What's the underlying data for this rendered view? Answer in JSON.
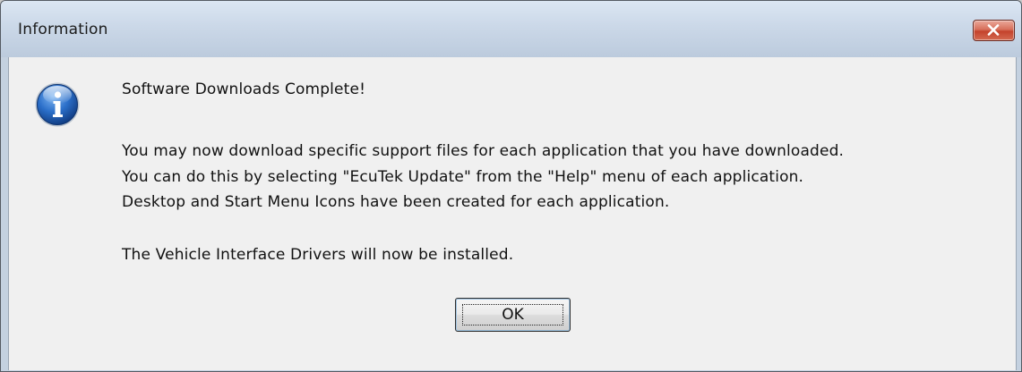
{
  "window": {
    "title": "Information"
  },
  "dialog": {
    "icon": "information-icon",
    "heading": "Software Downloads Complete!",
    "lines": [
      "You may now download specific support files for each application that you have downloaded.",
      "You can do this by selecting \"EcuTek Update\" from the \"Help\" menu of each application.",
      "Desktop and Start Menu Icons have been created for each application."
    ],
    "footer": "The Vehicle Interface Drivers will now be installed.",
    "ok_label": "OK"
  },
  "colors": {
    "titlebar": "#cbd8e8",
    "close_button": "#c4432c",
    "content_bg": "#f0f0f0",
    "info_icon": "#1f5fb8"
  }
}
